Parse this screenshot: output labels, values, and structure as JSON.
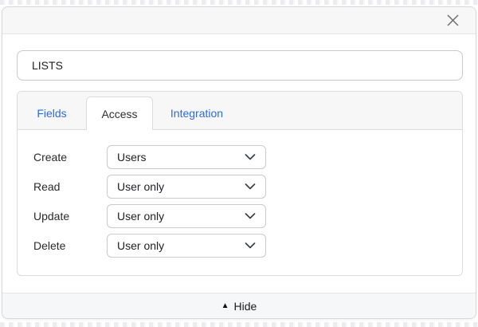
{
  "name_input": {
    "value": "LISTS"
  },
  "tabs": {
    "fields": {
      "label": "Fields",
      "active": false
    },
    "access": {
      "label": "Access",
      "active": true
    },
    "integration": {
      "label": "Integration",
      "active": false
    }
  },
  "access_rows": [
    {
      "label": "Create",
      "value": "Users"
    },
    {
      "label": "Read",
      "value": "User only"
    },
    {
      "label": "Update",
      "value": "User only"
    },
    {
      "label": "Delete",
      "value": "User only"
    }
  ],
  "footer": {
    "hide_icon": "▲",
    "hide_label": "Hide"
  },
  "icons": {
    "close": "close-icon",
    "chevron": "chevron-down-icon"
  },
  "colors": {
    "accent_blue": "#2b6be4",
    "header_bg": "#f7f7f8",
    "footer_bg": "#f6f7f8",
    "border": "#dcdcde",
    "text_dark": "#202124"
  }
}
